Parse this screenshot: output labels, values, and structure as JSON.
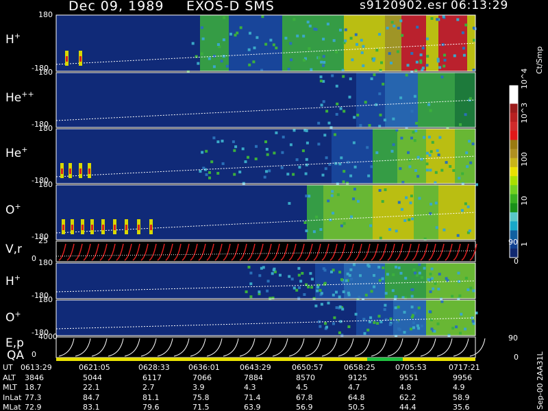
{
  "header": {
    "date": "Dec 09, 1989",
    "instrument": "EXOS-D SMS",
    "file": "s9120902.esr",
    "time": "06:13:29"
  },
  "chart_data": {
    "type": "heatmap",
    "panels": [
      {
        "base": "H",
        "sup": "+",
        "ytop": "180",
        "ybot": "-180"
      },
      {
        "base": "He",
        "sup": "++",
        "ytop": "180",
        "ybot": "-180"
      },
      {
        "base": "He",
        "sup": "+",
        "ytop": "180",
        "ybot": "-180"
      },
      {
        "base": "O",
        "sup": "+",
        "ytop": "180",
        "ybot": "-180"
      },
      {
        "base": "V,r",
        "sup": "",
        "ytop": "25",
        "ybot": "0",
        "right_top": "90",
        "right_bot": "0"
      },
      {
        "base": "H",
        "sup": "+",
        "ytop": "180",
        "ybot": "-180"
      },
      {
        "base": "O",
        "sup": "+",
        "ytop": "180",
        "ybot": "-180"
      },
      {
        "base": "E,p",
        "sup": "",
        "ytop": "4000",
        "ybot": "0",
        "right_top": "90",
        "right_bot": "0"
      }
    ],
    "qa_label": "QA",
    "colorbar": {
      "unit": "Ct/Smp",
      "labels": [
        "10^4",
        "10^3",
        "100",
        "10",
        "1"
      ],
      "colors": [
        "#ffffff",
        "#ffffff",
        "#9c1c1c",
        "#b82020",
        "#d02a2a",
        "#e01818",
        "#9a7a10",
        "#b09020",
        "#c8b418",
        "#e8e000",
        "#a8e000",
        "#70d020",
        "#38b020",
        "#189018",
        "#58c8c8",
        "#18a8c8",
        "#1060a0",
        "#104090",
        "#102870"
      ]
    },
    "ephemeris": {
      "rows": [
        {
          "label": "UT",
          "values": [
            "0613:29",
            "0621:05",
            "0628:33",
            "0636:01",
            "0643:29",
            "0650:57",
            "0658:25",
            "0705:53",
            "0717:21"
          ]
        },
        {
          "label": "ALT",
          "values": [
            "3846",
            "5044",
            "6117",
            "7066",
            "7884",
            "8570",
            "9125",
            "9551",
            "9956"
          ]
        },
        {
          "label": "MLT",
          "values": [
            "18.7",
            "22.1",
            "2.7",
            "3.9",
            "4.3",
            "4.5",
            "4.7",
            "4.8",
            "4.9"
          ]
        },
        {
          "label": "InLat",
          "values": [
            "77.3",
            "84.7",
            "81.1",
            "75.8",
            "71.4",
            "67.8",
            "64.8",
            "62.2",
            "58.9"
          ]
        },
        {
          "label": "MLat",
          "values": [
            "72.9",
            "83.1",
            "79.6",
            "71.5",
            "63.9",
            "56.9",
            "50.5",
            "44.4",
            "35.6"
          ]
        }
      ]
    }
  },
  "footer_id": "Sep-00 2AA31L"
}
